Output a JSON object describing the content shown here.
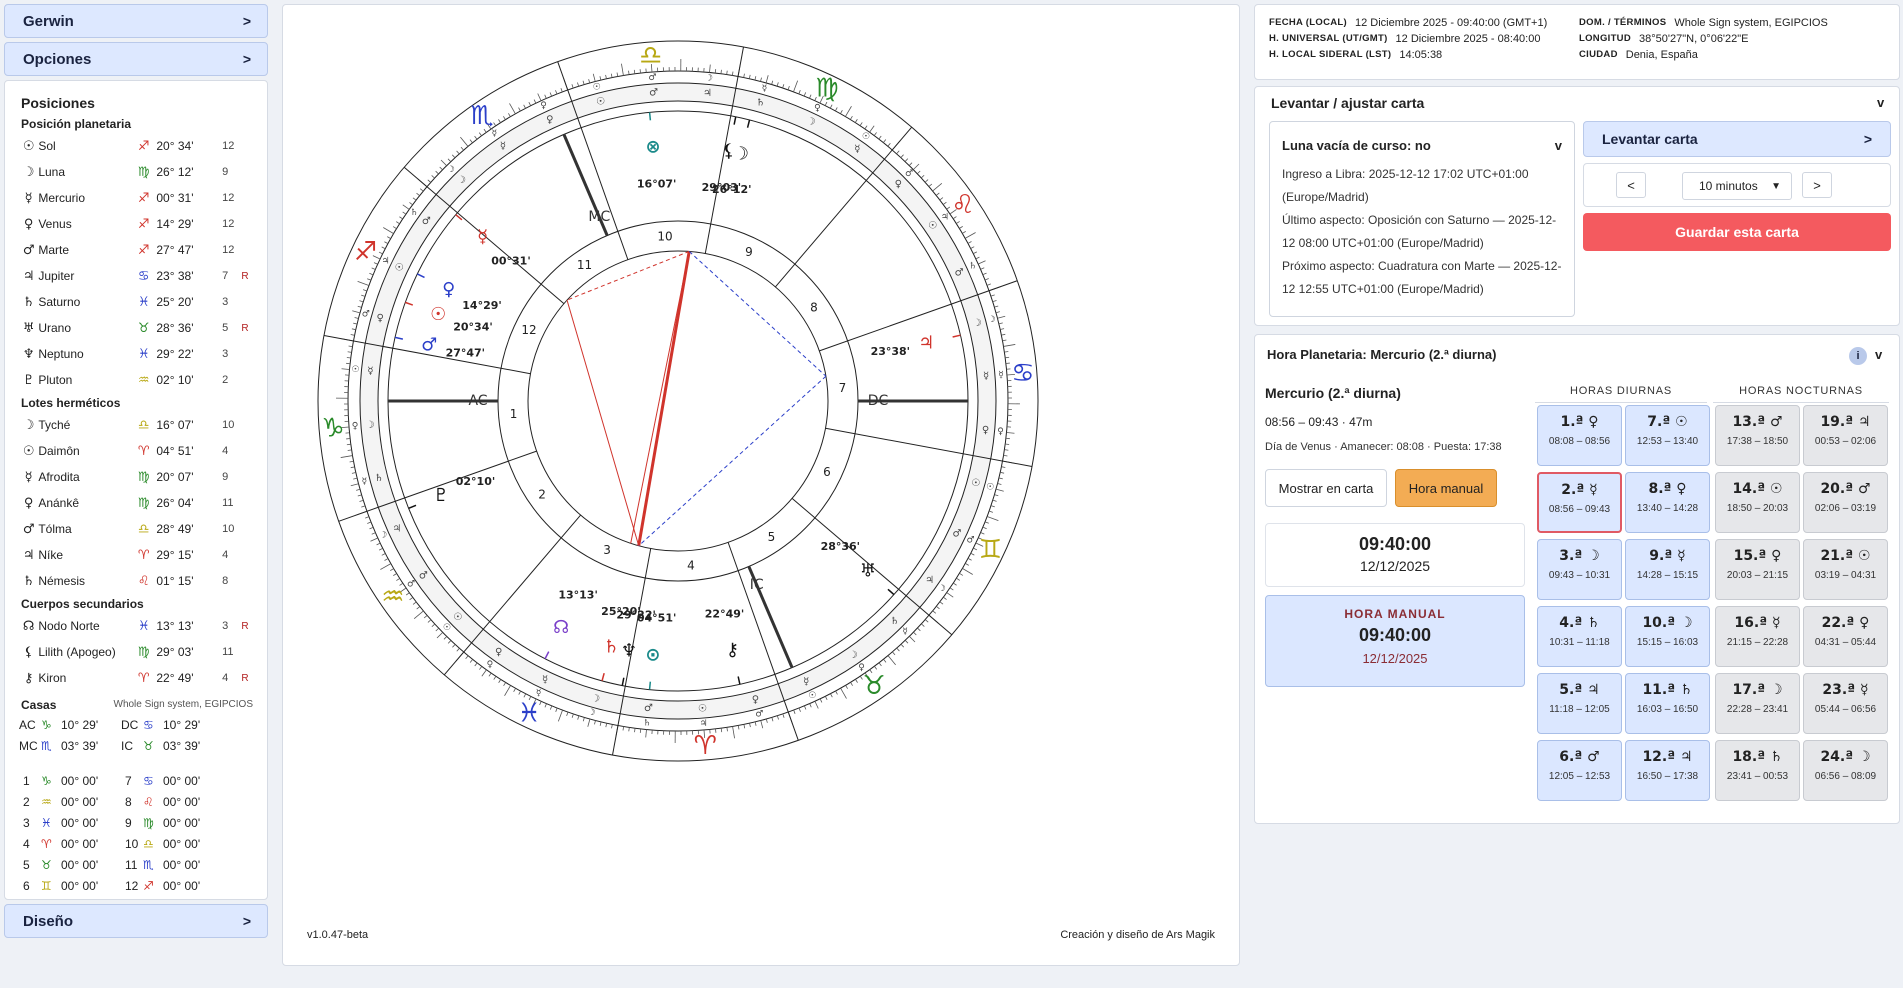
{
  "sidebar": {
    "gerwin_label": "Gerwin",
    "opciones_label": "Opciones",
    "diseno_label": "Diseño",
    "chevron": ">",
    "posiciones_title": "Posiciones",
    "planetaria_title": "Posición planetaria",
    "lotes_title": "Lotes herméticos",
    "cuerpos_title": "Cuerpos secundarios",
    "casas_title": "Casas",
    "casas_system": "Whole Sign system, EGIPCIOS",
    "planets": [
      {
        "glyph": "☉",
        "name": "Sol",
        "sign": "♐",
        "deg": "20° 34'",
        "house": "12",
        "retro": "",
        "color": "#d0342c"
      },
      {
        "glyph": "☽",
        "name": "Luna",
        "sign": "♍",
        "deg": "26° 12'",
        "house": "9",
        "retro": "",
        "color": "#2a8a2a"
      },
      {
        "glyph": "☿",
        "name": "Mercurio",
        "sign": "♐",
        "deg": "00° 31'",
        "house": "12",
        "retro": "",
        "color": "#d0342c"
      },
      {
        "glyph": "♀",
        "name": "Venus",
        "sign": "♐",
        "deg": "14° 29'",
        "house": "12",
        "retro": "",
        "color": "#d0342c"
      },
      {
        "glyph": "♂",
        "name": "Marte",
        "sign": "♐",
        "deg": "27° 47'",
        "house": "12",
        "retro": "",
        "color": "#d0342c"
      },
      {
        "glyph": "♃",
        "name": "Jupiter",
        "sign": "♋",
        "deg": "23° 38'",
        "house": "7",
        "retro": "R",
        "color": "#2b3fc9"
      },
      {
        "glyph": "♄",
        "name": "Saturno",
        "sign": "♓",
        "deg": "25° 20'",
        "house": "3",
        "retro": "",
        "color": "#2b3fc9"
      },
      {
        "glyph": "♅",
        "name": "Urano",
        "sign": "♉",
        "deg": "28° 36'",
        "house": "5",
        "retro": "R",
        "color": "#2a8a2a"
      },
      {
        "glyph": "♆",
        "name": "Neptuno",
        "sign": "♓",
        "deg": "29° 22'",
        "house": "3",
        "retro": "",
        "color": "#2b3fc9"
      },
      {
        "glyph": "♇",
        "name": "Pluton",
        "sign": "♒",
        "deg": "02° 10'",
        "house": "2",
        "retro": "",
        "color": "#b8a814"
      }
    ],
    "lotes": [
      {
        "glyph": "☽",
        "name": "Tyché",
        "sign": "♎",
        "deg": "16° 07'",
        "house": "10",
        "retro": "",
        "color": "#b8a814"
      },
      {
        "glyph": "☉",
        "name": "Daimôn",
        "sign": "♈",
        "deg": "04° 51'",
        "house": "4",
        "retro": "",
        "color": "#d0342c"
      },
      {
        "glyph": "☿",
        "name": "Afrodita",
        "sign": "♍",
        "deg": "20° 07'",
        "house": "9",
        "retro": "",
        "color": "#2a8a2a"
      },
      {
        "glyph": "♀",
        "name": "Anánkê",
        "sign": "♍",
        "deg": "26° 04'",
        "house": "11",
        "retro": "",
        "color": "#2a8a2a"
      },
      {
        "glyph": "♂",
        "name": "Tólma",
        "sign": "♎",
        "deg": "28° 49'",
        "house": "10",
        "retro": "",
        "color": "#b8a814"
      },
      {
        "glyph": "♃",
        "name": "Níke",
        "sign": "♈",
        "deg": "29° 15'",
        "house": "4",
        "retro": "",
        "color": "#d0342c"
      },
      {
        "glyph": "♄",
        "name": "Némesis",
        "sign": "♌",
        "deg": "01° 15'",
        "house": "8",
        "retro": "",
        "color": "#d0342c"
      }
    ],
    "cuerpos": [
      {
        "glyph": "☊",
        "name": "Nodo Norte",
        "sign": "♓",
        "deg": "13° 13'",
        "house": "3",
        "retro": "R",
        "color": "#2b3fc9"
      },
      {
        "glyph": "⚸",
        "name": "Lilith (Apogeo)",
        "sign": "♍",
        "deg": "29° 03'",
        "house": "11",
        "retro": "",
        "color": "#2a8a2a"
      },
      {
        "glyph": "⚷",
        "name": "Kiron",
        "sign": "♈",
        "deg": "22° 49'",
        "house": "4",
        "retro": "R",
        "color": "#d0342c"
      }
    ],
    "angles": [
      {
        "a": "AC",
        "sign": "♑",
        "deg": "10° 29'",
        "color": "#2a8a2a",
        "b": "DC",
        "sign2": "♋",
        "deg2": "10° 29'",
        "color2": "#2b3fc9"
      },
      {
        "a": "MC",
        "sign": "♏",
        "deg": "03° 39'",
        "color": "#2b3fc9",
        "b": "IC",
        "sign2": "♉",
        "deg2": "03° 39'",
        "color2": "#2a8a2a"
      }
    ],
    "houses": [
      {
        "n": "1",
        "sign": "♑",
        "deg": "00° 00'",
        "color": "#2a8a2a",
        "n2": "7",
        "sign2": "♋",
        "deg2": "00° 00'",
        "color2": "#2b3fc9"
      },
      {
        "n": "2",
        "sign": "♒",
        "deg": "00° 00'",
        "color": "#b8a814",
        "n2": "8",
        "sign2": "♌",
        "deg2": "00° 00'",
        "color2": "#d0342c"
      },
      {
        "n": "3",
        "sign": "♓",
        "deg": "00° 00'",
        "color": "#2b3fc9",
        "n2": "9",
        "sign2": "♍",
        "deg2": "00° 00'",
        "color2": "#2a8a2a"
      },
      {
        "n": "4",
        "sign": "♈",
        "deg": "00° 00'",
        "color": "#d0342c",
        "n2": "10",
        "sign2": "♎",
        "deg2": "00° 00'",
        "color2": "#b8a814"
      },
      {
        "n": "5",
        "sign": "♉",
        "deg": "00° 00'",
        "color": "#2a8a2a",
        "n2": "11",
        "sign2": "♏",
        "deg2": "00° 00'",
        "color2": "#2b3fc9"
      },
      {
        "n": "6",
        "sign": "♊",
        "deg": "00° 00'",
        "color": "#b8a814",
        "n2": "12",
        "sign2": "♐",
        "deg2": "00° 00'",
        "color2": "#d0342c"
      }
    ]
  },
  "chart": {
    "version": "v1.0.47-beta",
    "credit": "Creación y diseño de Ars Magik",
    "ascendant_deg": 280.48,
    "mc_deg": 213.65,
    "angle_labels": [
      "AC",
      "MC",
      "DC",
      "IC"
    ],
    "zodiac": [
      {
        "glyph": "♈",
        "color": "#d0342c"
      },
      {
        "glyph": "♉",
        "color": "#2a8a2a"
      },
      {
        "glyph": "♊",
        "color": "#b8a814"
      },
      {
        "glyph": "♋",
        "color": "#2b3fc9"
      },
      {
        "glyph": "♌",
        "color": "#d0342c"
      },
      {
        "glyph": "♍",
        "color": "#2a8a2a"
      },
      {
        "glyph": "♎",
        "color": "#b8a814"
      },
      {
        "glyph": "♏",
        "color": "#2b3fc9"
      },
      {
        "glyph": "♐",
        "color": "#d0342c"
      },
      {
        "glyph": "♑",
        "color": "#2a8a2a"
      },
      {
        "glyph": "♒",
        "color": "#b8a814"
      },
      {
        "glyph": "♓",
        "color": "#2b3fc9"
      }
    ],
    "house_numbers": [
      "1",
      "2",
      "3",
      "4",
      "5",
      "6",
      "7",
      "8",
      "9",
      "10",
      "11",
      "12"
    ],
    "bodies": [
      {
        "g": "☽",
        "lon": 176.2,
        "lbl": "26°12'",
        "color": "#111"
      },
      {
        "g": "⊗",
        "lon": 196.1,
        "lbl": "16°07'",
        "color": "#1a8a8a"
      },
      {
        "g": "☿",
        "lon": 240.5,
        "lbl": "00°31'",
        "color": "#d0342c"
      },
      {
        "g": "⚸",
        "lon": 179.0,
        "lbl": "29°03'",
        "color": "#111"
      },
      {
        "g": "♀",
        "lon": 254.5,
        "lbl": "14°29'",
        "color": "#2b3fc9"
      },
      {
        "g": "☉",
        "lon": 260.6,
        "lbl": "20°34'",
        "color": "#d0342c"
      },
      {
        "g": "♂",
        "lon": 267.8,
        "lbl": "27°47'",
        "color": "#2b3fc9"
      },
      {
        "g": "♇",
        "lon": 302.2,
        "lbl": "02°10'",
        "color": "#111"
      },
      {
        "g": "☊",
        "lon": 343.2,
        "lbl": "13°13'",
        "color": "#7a3fc9"
      },
      {
        "g": "♄",
        "lon": 355.3,
        "lbl": "25°20'",
        "color": "#d0342c"
      },
      {
        "g": "♆",
        "lon": 359.4,
        "lbl": "29°22'",
        "color": "#111"
      },
      {
        "g": "⊙",
        "lon": 4.85,
        "lbl": "04°51'",
        "color": "#1a8a8a"
      },
      {
        "g": "⚷",
        "lon": 22.8,
        "lbl": "22°49'",
        "color": "#111"
      },
      {
        "g": "♅",
        "lon": 58.6,
        "lbl": "28°36'",
        "color": "#111"
      },
      {
        "g": "♃",
        "lon": 113.6,
        "lbl": "23°38'",
        "color": "#d0342c"
      }
    ]
  },
  "info": {
    "fecha_k": "FECHA (LOCAL)",
    "fecha_v": "12 Diciembre 2025 - 09:40:00 (GMT+1)",
    "hu_k": "H. UNIVERSAL (UT/GMT)",
    "hu_v": "12 Diciembre 2025 - 08:40:00",
    "hls_k": "H. LOCAL SIDERAL (LST)",
    "hls_v": "14:05:38",
    "dom_k": "DOM. / TÉRMINOS",
    "dom_v": "Whole Sign system, EGIPCIOS",
    "lon_k": "LONGITUD",
    "lon_v": "38°50'27\"N, 0°06'22\"E",
    "ciudad_k": "CIUDAD",
    "ciudad_v": "Denia, España"
  },
  "levantar": {
    "title": "Levantar / ajustar carta",
    "chev": "v",
    "luna_title": "Luna vacía de curso: no",
    "luna_l1": "Ingreso a Libra: 2025-12-12 17:02 UTC+01:00 (Europe/Madrid)",
    "luna_l2": "Último aspecto: Oposición con Saturno — 2025-12-12 08:00 UTC+01:00 (Europe/Madrid)",
    "luna_l3": "Próximo aspecto: Cuadratura con Marte — 2025-12-12 12:55 UTC+01:00 (Europe/Madrid)",
    "btn_label": "Levantar carta",
    "prev": "<",
    "next": ">",
    "step": "10 minutos",
    "save": "Guardar esta carta"
  },
  "hora": {
    "title": "Hora Planetaria: Mercurio (2.ª diurna)",
    "info_icon": "i",
    "chev": "v",
    "subtitle": "Mercurio (2.ª diurna)",
    "range": "08:56 – 09:43 · 47m",
    "day": "Día de Venus · Amanecer: 08:08 · Puesta: 17:38",
    "mostrar": "Mostrar en carta",
    "manual_btn": "Hora manual",
    "time": "09:40:00",
    "date": "12/12/2025",
    "manual_label": "HORA MANUAL",
    "manual_time": "09:40:00",
    "manual_date": "12/12/2025",
    "diurnas_hdr": "HORAS DIURNAS",
    "nocturnas_hdr": "HORAS NOCTURNAS",
    "diurnas": [
      {
        "n": "1.ª ♀",
        "r": "08:08 – 08:56"
      },
      {
        "n": "7.ª ☉",
        "r": "12:53 – 13:40"
      },
      {
        "n": "2.ª ☿",
        "r": "08:56 – 09:43"
      },
      {
        "n": "8.ª ♀",
        "r": "13:40 – 14:28"
      },
      {
        "n": "3.ª ☽",
        "r": "09:43 – 10:31"
      },
      {
        "n": "9.ª ☿",
        "r": "14:28 – 15:15"
      },
      {
        "n": "4.ª ♄",
        "r": "10:31 – 11:18"
      },
      {
        "n": "10.ª ☽",
        "r": "15:15 – 16:03"
      },
      {
        "n": "5.ª ♃",
        "r": "11:18 – 12:05"
      },
      {
        "n": "11.ª ♄",
        "r": "16:03 – 16:50"
      },
      {
        "n": "6.ª ♂",
        "r": "12:05 – 12:53"
      },
      {
        "n": "12.ª ♃",
        "r": "16:50 – 17:38"
      }
    ],
    "nocturnas": [
      {
        "n": "13.ª ♂",
        "r": "17:38 – 18:50"
      },
      {
        "n": "19.ª ♃",
        "r": "00:53 – 02:06"
      },
      {
        "n": "14.ª ☉",
        "r": "18:50 – 20:03"
      },
      {
        "n": "20.ª ♂",
        "r": "02:06 – 03:19"
      },
      {
        "n": "15.ª ♀",
        "r": "20:03 – 21:15"
      },
      {
        "n": "21.ª ☉",
        "r": "03:19 – 04:31"
      },
      {
        "n": "16.ª ☿",
        "r": "21:15 – 22:28"
      },
      {
        "n": "22.ª ♀",
        "r": "04:31 – 05:44"
      },
      {
        "n": "17.ª ☽",
        "r": "22:28 – 23:41"
      },
      {
        "n": "23.ª ☿",
        "r": "05:44 – 06:56"
      },
      {
        "n": "18.ª ♄",
        "r": "23:41 – 00:53"
      },
      {
        "n": "24.ª ☽",
        "r": "06:56 – 08:09"
      }
    ]
  }
}
